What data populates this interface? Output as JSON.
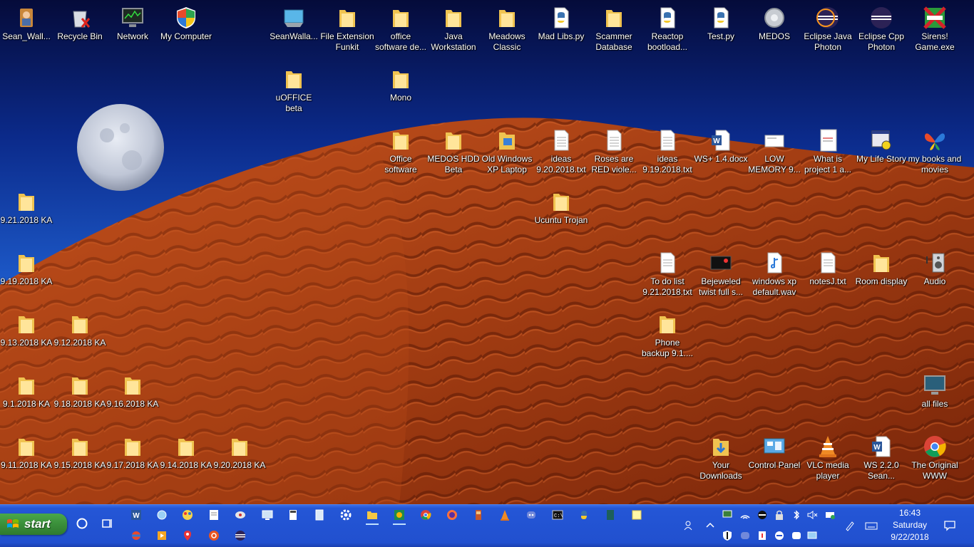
{
  "desktop": {
    "icons": {
      "sean_wall": "Sean_Wall...",
      "recycle_bin": "Recycle Bin",
      "network": "Network",
      "my_computer": "My Computer",
      "seanwalla": "SeanWalla...",
      "file_extension_funkit": "File Extension Funkit",
      "office_software_de": "office software de...",
      "java_workstation": "Java Workstation",
      "meadows_classic": "Meadows Classic",
      "mad_libs": "Mad Libs.py",
      "scammer_database": "Scammer Database",
      "reactop_bootload": "Reactop bootload...",
      "test_py": "Test.py",
      "medos": "MEDOS",
      "eclipse_java": "Eclipse Java Photon",
      "eclipse_cpp": "Eclipse Cpp Photon",
      "sirens": "Sirens! Game.exe",
      "uoffice_beta": "uOFFICE beta",
      "mono": "Mono",
      "office_software": "Office software",
      "medos_hdd_beta": "MEDOS HDD Beta",
      "old_windows_xp": "Old Windows XP Laptop",
      "ideas_920": "ideas 9.20.2018.txt",
      "roses_red": "Roses are RED viole...",
      "ideas_919": "ideas 9.19.2018.txt",
      "ws_docx": "WS+ 1.4.docx",
      "low_memory": "LOW MEMORY 9...",
      "what_is_project": "What is project 1 a...",
      "my_life_story": "My Life Story",
      "my_books": "my books and movies",
      "ucuntu_trojan": "Ucuntu Trojan",
      "ka_921": "9.21.2018 KA",
      "ka_919": "9.19.2018 KA",
      "ka_913": "9.13.2018 KA",
      "ka_912": "9.12.2018 KA",
      "ka_91": "9.1.2018 KA",
      "ka_918": "9.18.2018 KA",
      "ka_916": "9.16.2018 KA",
      "ka_911": "9.11.2018 KA",
      "ka_915": "9.15.2018 KA",
      "ka_917": "9.17.2018 KA",
      "ka_914": "9.14.2018 KA",
      "ka_920": "9.20.2018 KA",
      "todo_list": "To do list 9.21.2018.txt",
      "bejeweled": "Bejeweled twist full s...",
      "winxp_wav": "windows xp default.wav",
      "notesj": "notesJ.txt",
      "room_display": "Room display",
      "audio": "Audio",
      "phone_backup": "Phone backup 9.1....",
      "all_files": "all files",
      "your_downloads": "Your Downloads",
      "control_panel": "Control Panel",
      "vlc": "VLC media player",
      "ws220": "WS 2.2.0 Sean...",
      "original_www": "The Original WWW"
    }
  },
  "taskbar": {
    "start_label": "start",
    "time": "16:43",
    "day": "Saturday",
    "date": "9/22/2018"
  }
}
